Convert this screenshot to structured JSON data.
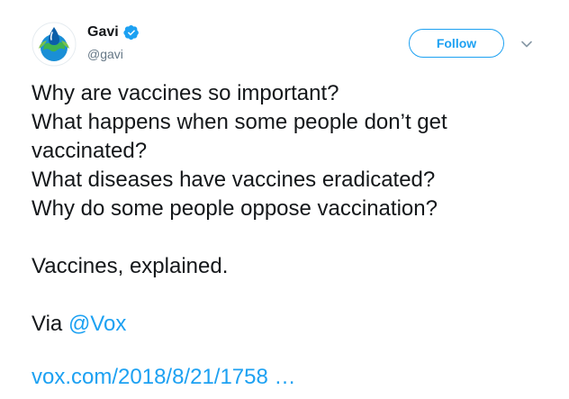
{
  "user": {
    "name": "Gavi",
    "handle": "@gavi"
  },
  "follow_button": {
    "label": "Follow"
  },
  "tweet": {
    "lines": [
      "Why are vaccines so important?",
      "What happens when some people don’t get",
      "vaccinated?",
      "What diseases have vaccines eradicated?",
      "Why do some people oppose vaccination?"
    ],
    "closing": "Vaccines, explained.",
    "via_prefix": "Via",
    "mention": "@Vox",
    "link": "vox.com/2018/8/21/1758 …"
  },
  "colors": {
    "accent": "#1da1f2",
    "text": "#14171a",
    "muted": "#657786"
  },
  "icons": {
    "verified": "verified-badge-icon",
    "caret": "chevron-down-icon",
    "avatar": "gavi-logo"
  }
}
